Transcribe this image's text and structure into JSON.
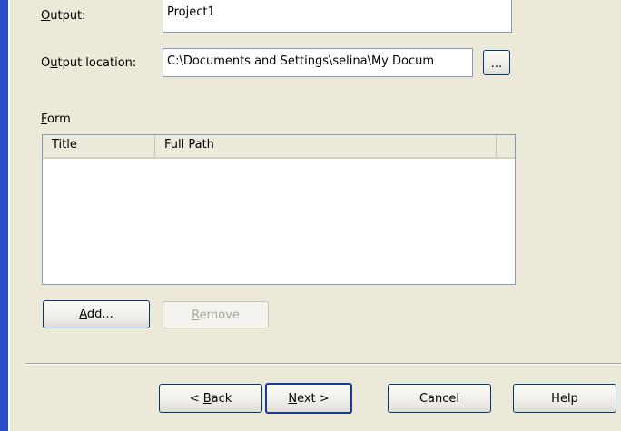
{
  "output": {
    "label": "Output:",
    "value": "Project1"
  },
  "output_location": {
    "label": "Output location:",
    "value": "C:\\Documents and Settings\\selina\\My Docum",
    "browse_label": "..."
  },
  "form": {
    "label": "Form",
    "columns": [
      "Title",
      "Full Path"
    ],
    "rows": [],
    "add_label": "Add...",
    "remove_label": "Remove"
  },
  "footer": {
    "back_label": "< Back",
    "next_label": "Next >",
    "cancel_label": "Cancel",
    "help_label": "Help"
  },
  "colors": {
    "dialog_bg": "#ece9d8",
    "accent_bar": "#2a4fc8"
  }
}
